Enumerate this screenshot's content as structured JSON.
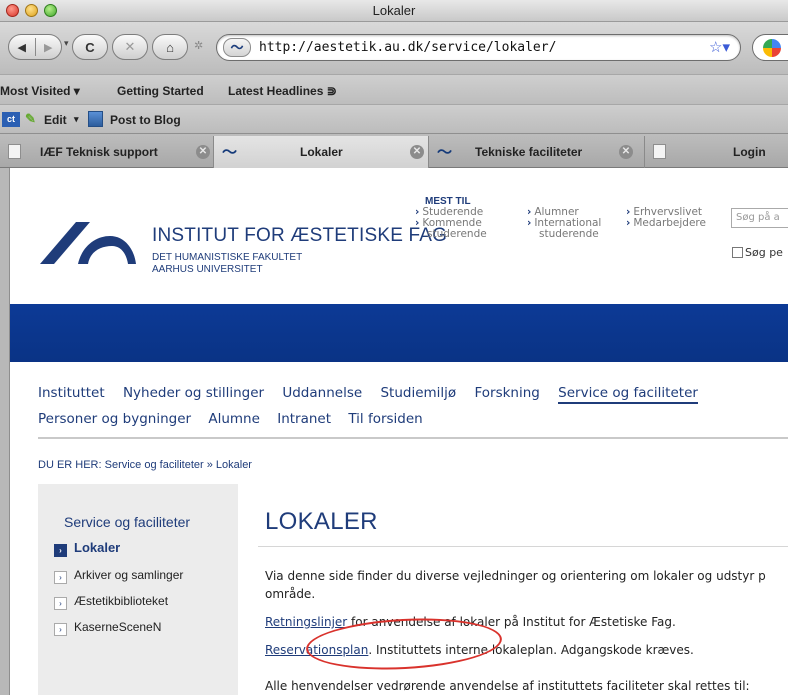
{
  "window": {
    "title": "Lokaler"
  },
  "toolbar": {
    "back_icon": "◀",
    "forward_icon": "▶",
    "reload_icon": "C",
    "stop_icon": "✕",
    "home_icon": "⌂",
    "url": "http://aestetik.au.dk/service/lokaler/"
  },
  "bookmarks": [
    "Most Visited ▾",
    "Getting Started",
    "Latest Headlines ⋑"
  ],
  "editbar": {
    "edit": "Edit",
    "post": "Post to Blog"
  },
  "tabs": [
    {
      "label": "IÆF Teknisk support"
    },
    {
      "label": "Lokaler",
      "active": true
    },
    {
      "label": "Tekniske faciliteter"
    },
    {
      "label": "Login"
    }
  ],
  "header": {
    "title": "INSTITUT FOR ÆSTETISKE FAG",
    "subtitle1": "DET HUMANISTISKE FAKULTET",
    "subtitle2": "AARHUS UNIVERSITET",
    "mest_til": "MEST TIL",
    "targets": [
      [
        "Studerende",
        "Kommende",
        "studerende"
      ],
      [
        "Alumner",
        "International",
        "studerende"
      ],
      [
        "Erhvervslivet",
        "Medarbejdere"
      ]
    ],
    "search_placeholder": "Søg på a",
    "search_checkbox": "Søg pe"
  },
  "mainnav": [
    "Instituttet",
    "Nyheder og stillinger",
    "Uddannelse",
    "Studiemiljø",
    "Forskning",
    "Service og faciliteter"
  ],
  "subnav": [
    "Personer og bygninger",
    "Alumne",
    "Intranet",
    "Til forsiden"
  ],
  "breadcrumb": "DU ER HER: Service og faciliteter » Lokaler",
  "sidebar": {
    "heading": "Service og faciliteter",
    "items": [
      "Lokaler",
      "Arkiver og samlinger",
      "Æstetikbiblioteket",
      "KaserneSceneN"
    ]
  },
  "content": {
    "heading": "LOKALER",
    "intro1": "Via denne side finder du diverse vejledninger og orientering om lokaler og udstyr p",
    "intro2": "område.",
    "link1": "Retningslinjer",
    "link1_rest": " for anvendelse af lokaler på Institut for Æstetiske Fag.",
    "link2": "Reservationsplan",
    "link2_rest": ". Instituttets interne lokaleplan. Adgangskode kræves.",
    "closing": "Alle henvendelser vedrørende anvendelse af instituttets faciliteter skal rettes til:"
  },
  "colors": {
    "brand": "#1f3c7a",
    "banner": "#0c3a96",
    "annotation": "#d9322c"
  }
}
